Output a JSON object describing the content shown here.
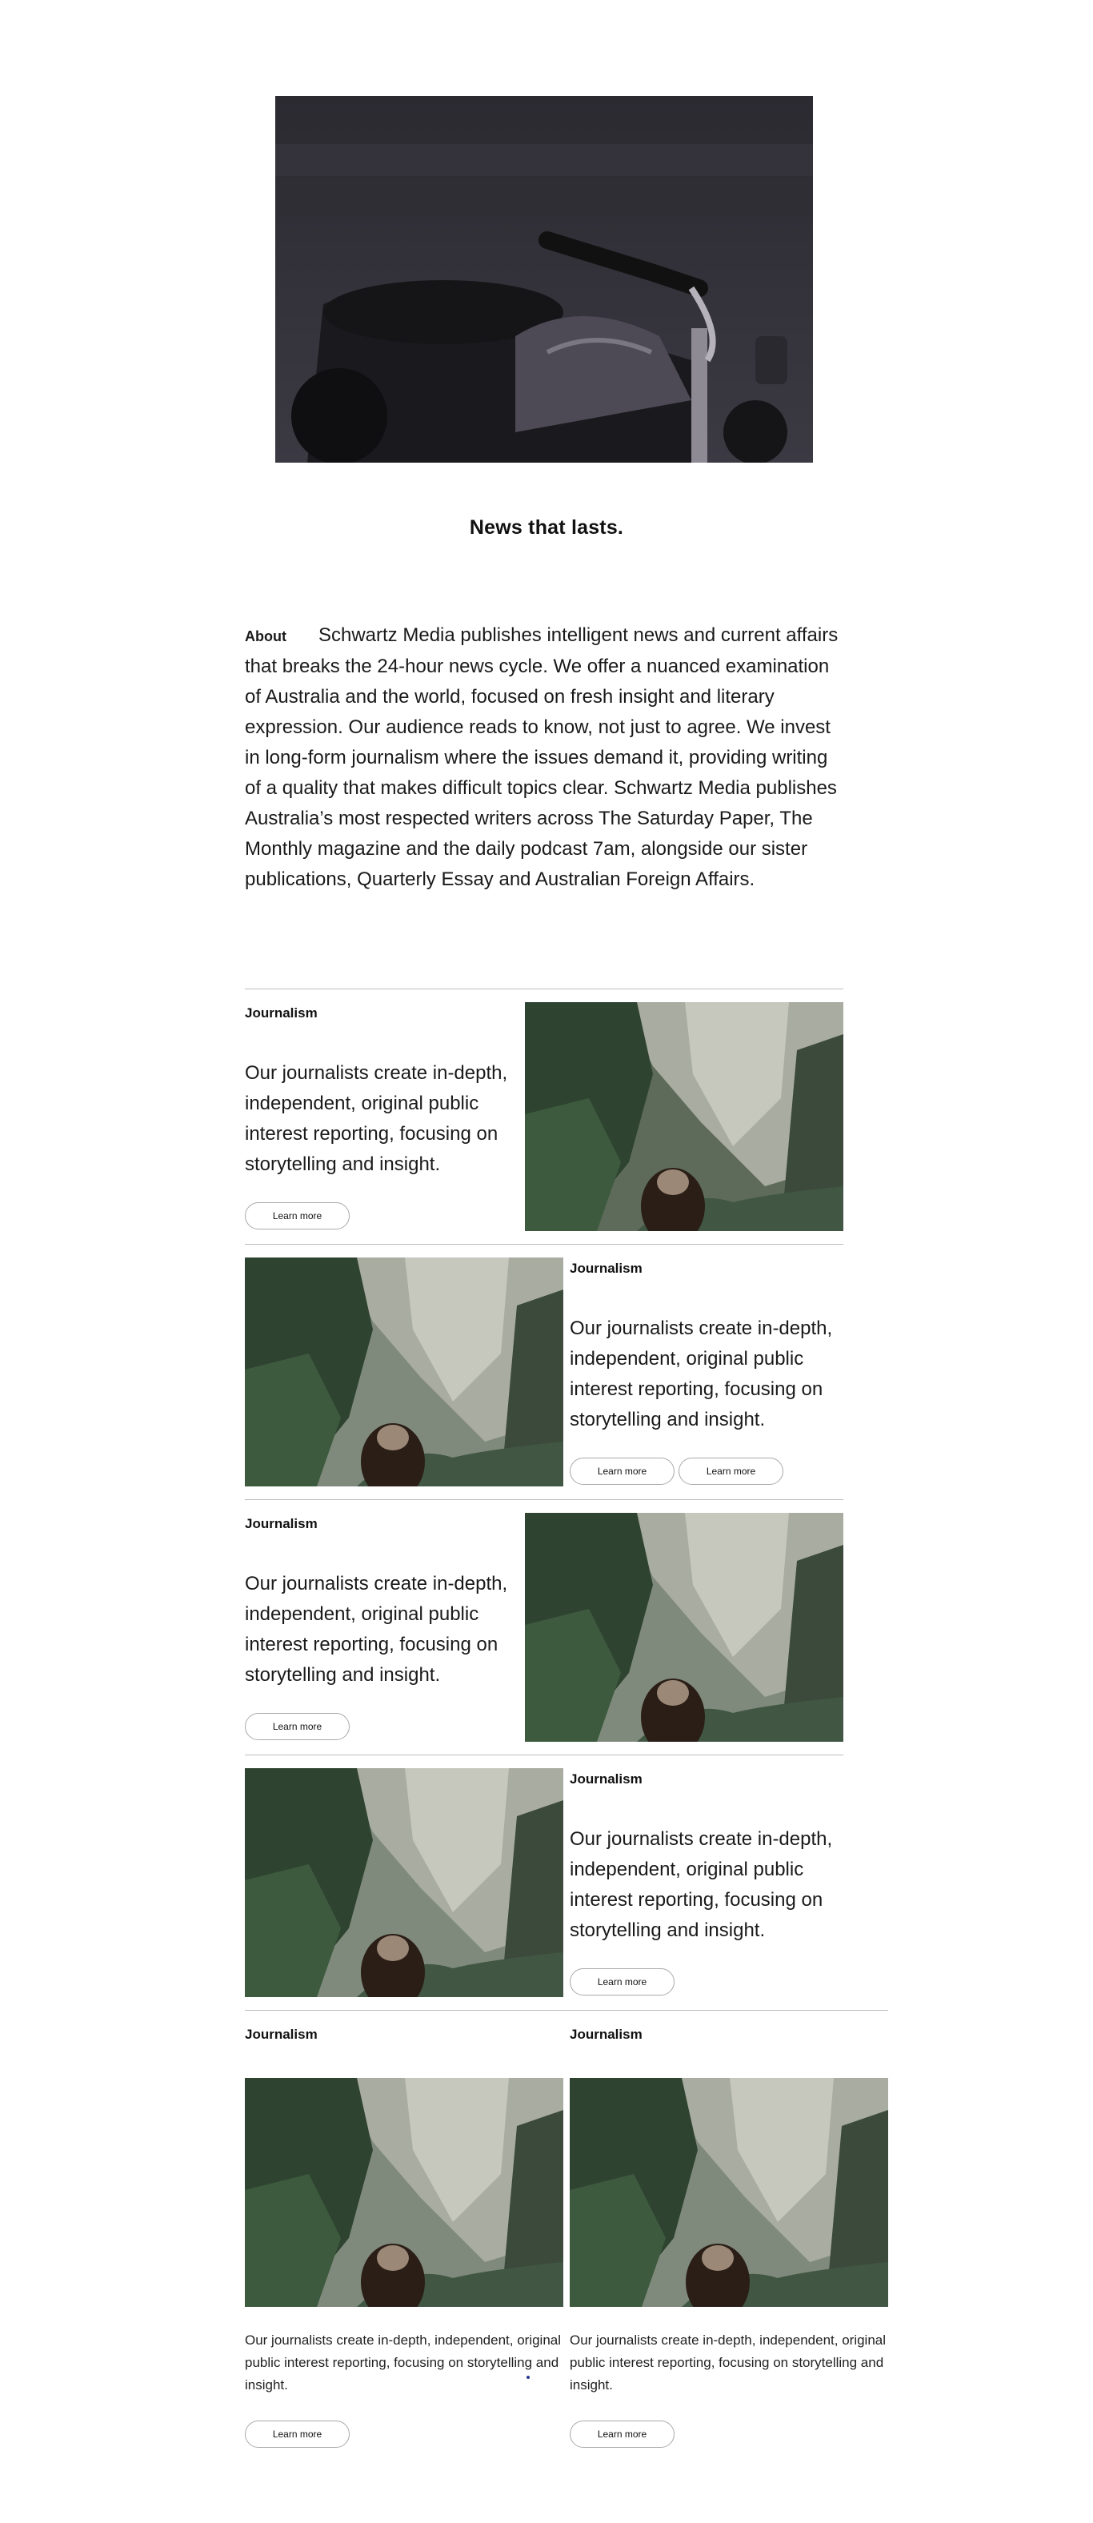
{
  "hero": {
    "tagline": "News that lasts."
  },
  "about": {
    "label": "About",
    "text": "Schwartz Media publishes intelligent news and current affairs that breaks the 24-hour news cycle. We offer a nuanced examination of Australia and the world, focused on fresh insight and literary expression. Our audience reads to know, not just to agree. We invest in long-form journalism where the issues demand it, providing writing of a quality that makes difficult topics clear. Schwartz Media publishes Australia’s most respected writers across The Saturday Paper, The Monthly magazine and the daily podcast 7am, alongside our sister publications, Quarterly Essay and Australian Foreign Affairs."
  },
  "features": [
    {
      "kicker": "Journalism",
      "text": "Our journalists create in-depth, independent, original public interest reporting, focusing on storytelling and insight.",
      "buttons": [
        "Learn more"
      ]
    },
    {
      "kicker": "Journalism",
      "text": "Our journalists create in-depth, independent, original public interest reporting, focusing on storytelling and insight.",
      "buttons": [
        "Learn more",
        "Learn more"
      ]
    },
    {
      "kicker": "Journalism",
      "text": "Our journalists create in-depth, independent, original public interest reporting, focusing on storytelling and insight.",
      "buttons": [
        "Learn more"
      ]
    },
    {
      "kicker": "Journalism",
      "text": "Our journalists create in-depth, independent, original public interest reporting, focusing on storytelling and insight.",
      "buttons": [
        "Learn more"
      ]
    }
  ],
  "cards": [
    {
      "kicker": "Journalism",
      "text": "Our journalists create in-depth, independent, original public interest reporting, focusing on storytelling and insight.",
      "button": "Learn more"
    },
    {
      "kicker": "Journalism",
      "text": "Our journalists create in-depth, independent, original public interest reporting, focusing on storytelling and insight.",
      "button": "Learn more"
    }
  ]
}
